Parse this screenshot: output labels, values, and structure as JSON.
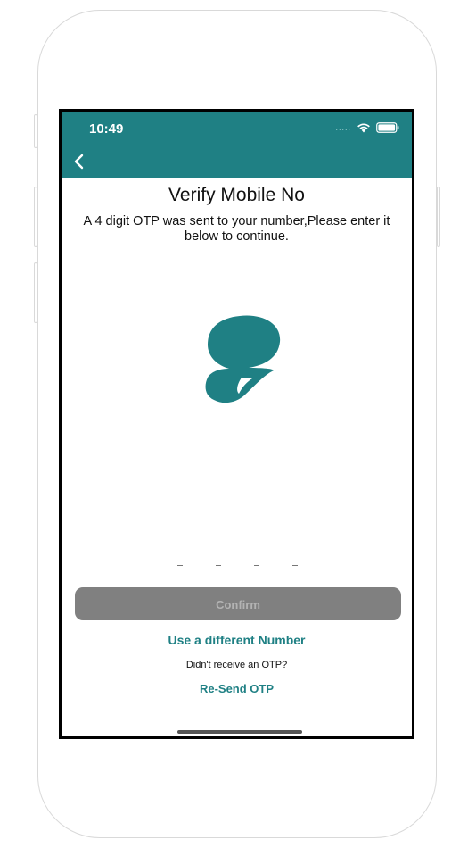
{
  "status_bar": {
    "time": "10:49",
    "signal_dots": "....."
  },
  "header": {
    "back_icon": "chevron-left-icon"
  },
  "content": {
    "title": "Verify Mobile No",
    "subtitle": "A 4 digit OTP was sent to your number,Please enter it below to continue.",
    "logo_icon": "brand-logo-icon",
    "otp_slots": [
      "-",
      "-",
      "-",
      "-"
    ],
    "confirm_label": "Confirm",
    "different_number_label": "Use a different Number",
    "didnt_receive_text": "Didn't receive an OTP?",
    "resend_label": "Re-Send OTP"
  },
  "colors": {
    "accent": "#1f8084",
    "button_disabled": "#808080",
    "button_text_disabled": "#b3b3b3"
  }
}
